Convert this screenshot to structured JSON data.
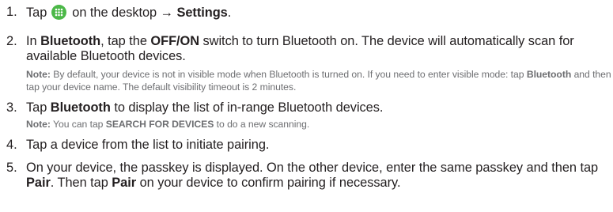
{
  "steps": [
    {
      "number": "1.",
      "parts": {
        "t1": "Tap ",
        "t2": " on the desktop → ",
        "b1": "Settings",
        "t3": "."
      },
      "icon": "apps-grid-icon"
    },
    {
      "number": "2.",
      "parts": {
        "t1": "In ",
        "b1": "Bluetooth",
        "t2": ", tap the ",
        "b2": "OFF/ON",
        "t3": " switch to turn Bluetooth on. The device will automatically scan for available Bluetooth devices."
      },
      "note": {
        "label": "Note:",
        "t1": " By default, your device is not in visible mode when Bluetooth is turned on. If you need to enter visible mode: tap ",
        "b1": "Bluetooth",
        "t2": " and then tap your device name. The default visibility timeout is 2 minutes."
      }
    },
    {
      "number": "3.",
      "parts": {
        "t1": "Tap ",
        "b1": "Bluetooth",
        "t2": " to display the list of in-range Bluetooth devices."
      },
      "note": {
        "label": "Note:",
        "t1": " You can tap ",
        "b1": "SEARCH FOR DEVICES",
        "t2": " to do a new scanning."
      }
    },
    {
      "number": "4.",
      "parts": {
        "t1": "Tap a device from the list to initiate pairing."
      }
    },
    {
      "number": "5.",
      "parts": {
        "t1": "On your device, the passkey is displayed. On the other device, enter the same passkey and then tap ",
        "b1": "Pair",
        "t2": ". Then tap ",
        "b2": "Pair",
        "t3": " on your device to confirm pairing if necessary."
      }
    }
  ],
  "colors": {
    "text": "#231f20",
    "note_text": "#6d6e71",
    "icon_green": "#4cb848"
  }
}
